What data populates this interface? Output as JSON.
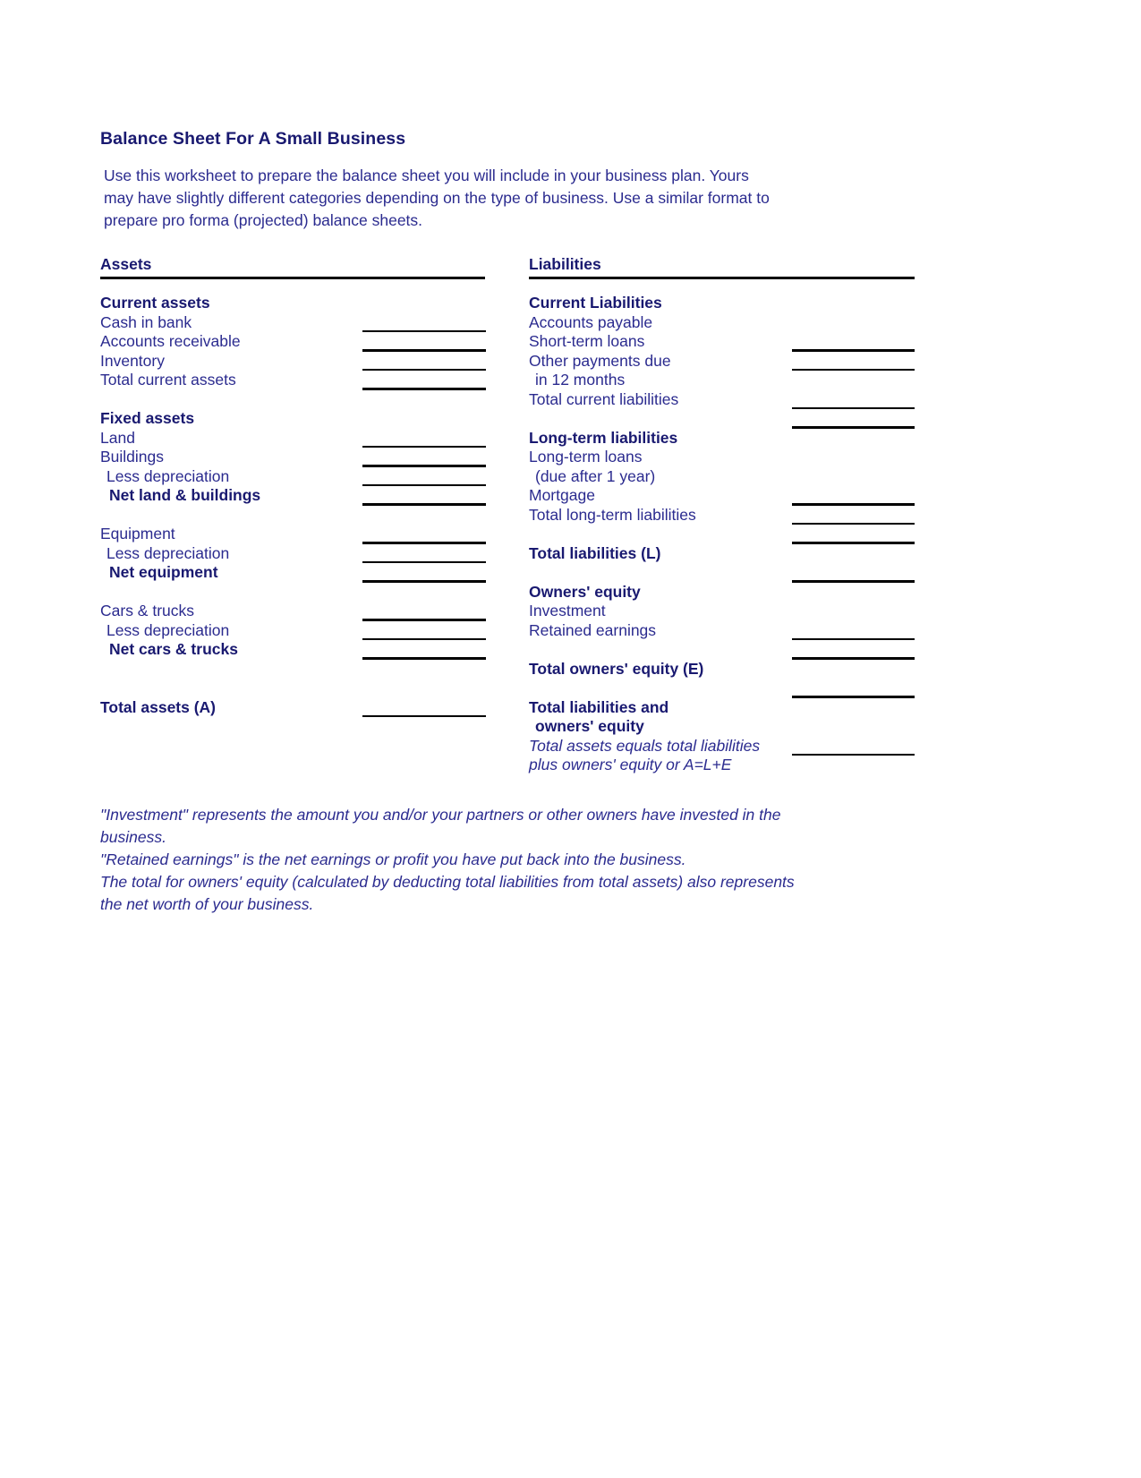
{
  "document": {
    "title": "Balance Sheet For A Small Business",
    "intro_lines": [
      "Use this worksheet to prepare the balance sheet you will include in your business plan.  Yours",
      "may have slightly different categories depending on the type of business.  Use a similar format to",
      "prepare pro forma (projected) balance sheets."
    ],
    "text_color": "#191970",
    "rule_color": "#000000"
  },
  "assets_column": {
    "header": "Assets",
    "rows": [
      {
        "label": "Current assets",
        "bold": true,
        "indent": 0,
        "line": false
      },
      {
        "label": "Cash in bank",
        "bold": false,
        "indent": 0,
        "line": true
      },
      {
        "label": "Accounts receivable",
        "bold": false,
        "indent": 0,
        "line": true
      },
      {
        "label": "Inventory",
        "bold": false,
        "indent": 0,
        "line": true
      },
      {
        "label": "Total current assets",
        "bold": false,
        "indent": 0,
        "line": true
      },
      {
        "label": "",
        "bold": false,
        "indent": 0,
        "line": false
      },
      {
        "label": "Fixed assets",
        "bold": true,
        "indent": 0,
        "line": false
      },
      {
        "label": "Land",
        "bold": false,
        "indent": 0,
        "line": true
      },
      {
        "label": "Buildings",
        "bold": false,
        "indent": 0,
        "line": true
      },
      {
        "label": "Less depreciation",
        "bold": false,
        "indent": 1,
        "line": true
      },
      {
        "label": "Net land & buildings",
        "bold": true,
        "indent": 2,
        "line": true
      },
      {
        "label": "",
        "bold": false,
        "indent": 0,
        "line": false
      },
      {
        "label": "Equipment",
        "bold": false,
        "indent": 0,
        "line": true
      },
      {
        "label": "Less depreciation",
        "bold": false,
        "indent": 1,
        "line": true
      },
      {
        "label": "Net equipment",
        "bold": true,
        "indent": 2,
        "line": true
      },
      {
        "label": "",
        "bold": false,
        "indent": 0,
        "line": false
      },
      {
        "label": "Cars & trucks",
        "bold": false,
        "indent": 0,
        "line": true
      },
      {
        "label": "Less depreciation",
        "bold": false,
        "indent": 1,
        "line": true
      },
      {
        "label": "Net cars & trucks",
        "bold": true,
        "indent": 2,
        "line": true
      },
      {
        "label": "",
        "bold": false,
        "indent": 0,
        "line": false
      },
      {
        "label": "",
        "bold": false,
        "indent": 0,
        "line": false
      },
      {
        "label": "Total assets (A)",
        "bold": true,
        "indent": 0,
        "line": true
      }
    ]
  },
  "liabilities_column": {
    "header": "Liabilities",
    "rows": [
      {
        "label": "Current Liabilities",
        "bold": true,
        "indent": 0,
        "line": false,
        "italic": false
      },
      {
        "label": "Accounts payable",
        "bold": false,
        "indent": 0,
        "line": false,
        "italic": false
      },
      {
        "label": "Short-term loans",
        "bold": false,
        "indent": 0,
        "line": true,
        "italic": false
      },
      {
        "label": "Other payments due",
        "bold": false,
        "indent": 0,
        "line": true,
        "italic": false
      },
      {
        "label": "in 12 months",
        "bold": false,
        "indent": 1,
        "line": false,
        "italic": false
      },
      {
        "label": "Total current liabilities",
        "bold": false,
        "indent": 0,
        "line": true,
        "italic": false
      },
      {
        "label": "",
        "bold": false,
        "indent": 0,
        "line": true,
        "italic": false
      },
      {
        "label": "Long-term liabilities",
        "bold": true,
        "indent": 0,
        "line": false,
        "italic": false
      },
      {
        "label": "Long-term loans",
        "bold": false,
        "indent": 0,
        "line": false,
        "italic": false
      },
      {
        "label": "(due after 1 year)",
        "bold": false,
        "indent": 1,
        "line": false,
        "italic": false
      },
      {
        "label": "Mortgage",
        "bold": false,
        "indent": 0,
        "line": true,
        "italic": false
      },
      {
        "label": "Total long-term liabilities",
        "bold": false,
        "indent": 0,
        "line": true,
        "italic": false
      },
      {
        "label": "",
        "bold": false,
        "indent": 0,
        "line": true,
        "italic": false
      },
      {
        "label": "Total liabilities (L)",
        "bold": true,
        "indent": 0,
        "line": false,
        "italic": false
      },
      {
        "label": "",
        "bold": false,
        "indent": 0,
        "line": true,
        "italic": false
      },
      {
        "label": "Owners' equity",
        "bold": true,
        "indent": 0,
        "line": false,
        "italic": false
      },
      {
        "label": "Investment",
        "bold": false,
        "indent": 0,
        "line": false,
        "italic": false
      },
      {
        "label": "Retained earnings",
        "bold": false,
        "indent": 0,
        "line": true,
        "italic": false
      },
      {
        "label": "",
        "bold": false,
        "indent": 0,
        "line": true,
        "italic": false
      },
      {
        "label": "Total owners' equity (E)",
        "bold": true,
        "indent": 0,
        "line": false,
        "italic": false
      },
      {
        "label": "",
        "bold": false,
        "indent": 0,
        "line": true,
        "italic": false
      },
      {
        "label": "Total liabilities and",
        "bold": true,
        "indent": 0,
        "line": false,
        "italic": false
      },
      {
        "label": "owners' equity",
        "bold": true,
        "indent": 1,
        "line": false,
        "italic": false
      },
      {
        "label": "Total assets equals total liabilities",
        "bold": false,
        "indent": 0,
        "line": true,
        "italic": true
      },
      {
        "label": "plus owners' equity or A=L+E",
        "bold": false,
        "indent": 0,
        "line": false,
        "italic": true
      }
    ]
  },
  "notes": {
    "lines": [
      "\"Investment\" represents the amount you and/or your partners or other owners have invested in the",
      "business.",
      "\"Retained earnings\" is the net earnings or profit you have put back into the business.",
      "The total for owners' equity (calculated by deducting total liabilities from total assets) also represents",
      "the net worth of your business."
    ]
  }
}
